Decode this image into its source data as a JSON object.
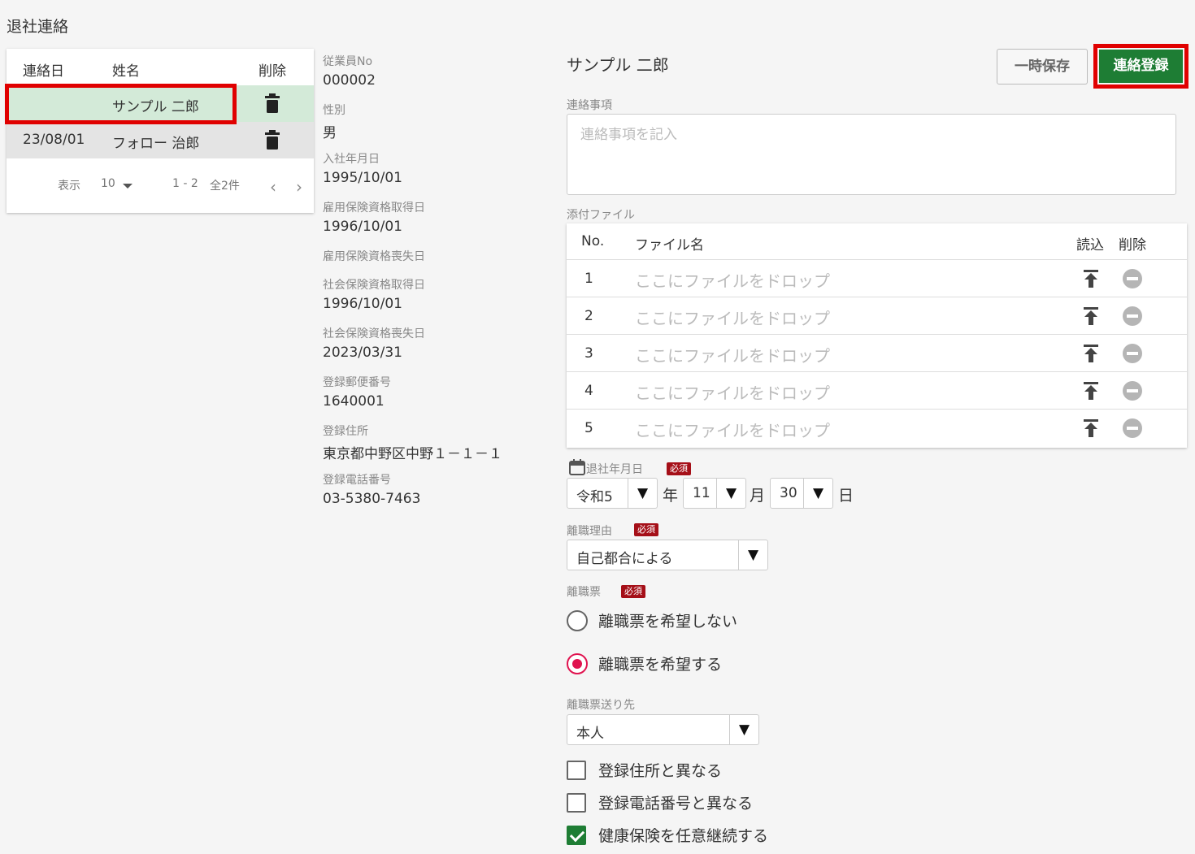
{
  "page": {
    "title": "退社連絡"
  },
  "list": {
    "headers": {
      "date": "連絡日",
      "name": "姓名",
      "delete": "削除"
    },
    "rows": [
      {
        "date": "",
        "name": "サンプル 二郎"
      },
      {
        "date": "23/08/01",
        "name": "フォロー 治郎"
      }
    ],
    "pager": {
      "show_label": "表示",
      "page_size": "10",
      "range": "1 - 2",
      "total": "全2件"
    }
  },
  "employee": {
    "fields": [
      {
        "label": "従業員No",
        "value": "000002"
      },
      {
        "label": "性別",
        "value": "男"
      },
      {
        "label": "入社年月日",
        "value": "1995/10/01"
      },
      {
        "label": "雇用保険資格取得日",
        "value": "1996/10/01"
      },
      {
        "label": "雇用保険資格喪失日",
        "value": ""
      },
      {
        "label": "社会保険資格取得日",
        "value": "1996/10/01"
      },
      {
        "label": "社会保険資格喪失日",
        "value": "2023/03/31"
      },
      {
        "label": "登録郵便番号",
        "value": "1640001"
      },
      {
        "label": "登録住所",
        "value": "東京都中野区中野１－１－１"
      },
      {
        "label": "登録電話番号",
        "value": "03-5380-7463"
      }
    ]
  },
  "form": {
    "name": "サンプル 二郎",
    "save_label": "一時保存",
    "register_label": "連絡登録",
    "notes_label": "連絡事項",
    "notes_placeholder": "連絡事項を記入",
    "attach_label": "添付ファイル",
    "attach_headers": {
      "no": "No.",
      "filename": "ファイル名",
      "read": "読込",
      "delete": "削除"
    },
    "attach_rows": [
      {
        "no": "1",
        "placeholder": "ここにファイルをドロップ"
      },
      {
        "no": "2",
        "placeholder": "ここにファイルをドロップ"
      },
      {
        "no": "3",
        "placeholder": "ここにファイルをドロップ"
      },
      {
        "no": "4",
        "placeholder": "ここにファイルをドロップ"
      },
      {
        "no": "5",
        "placeholder": "ここにファイルをドロップ"
      }
    ],
    "required_badge": "必須",
    "retire_date": {
      "label": "退社年月日",
      "era": "令和5",
      "year_unit": "年",
      "month": "11",
      "month_unit": "月",
      "day": "30",
      "day_unit": "日"
    },
    "reason": {
      "label": "離職理由",
      "value": "自己都合による"
    },
    "slip": {
      "label": "離職票",
      "options": [
        {
          "label": "離職票を希望しない",
          "checked": false
        },
        {
          "label": "離職票を希望する",
          "checked": true
        }
      ]
    },
    "send_to": {
      "label": "離職票送り先",
      "value": "本人"
    },
    "checks": [
      {
        "label": "登録住所と異なる",
        "checked": false
      },
      {
        "label": "登録電話番号と異なる",
        "checked": false
      },
      {
        "label": "健康保険を任意継続する",
        "checked": true
      }
    ],
    "arrow": "▼"
  },
  "colors": {
    "accent_green": "#1e7d34",
    "highlight_red": "#e00000",
    "required_badge": "#a50f18",
    "radio_active": "#e0134f",
    "selected_row": "#d3ead8"
  }
}
